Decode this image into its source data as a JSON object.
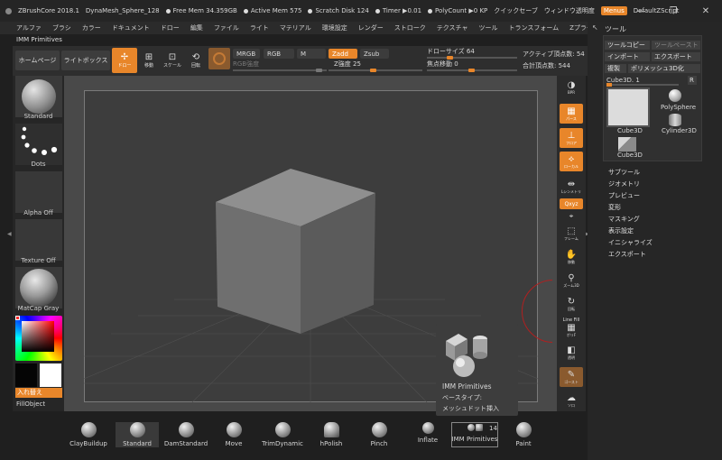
{
  "titlebar": {
    "app": "ZBrushCore 2018.1",
    "document": "DynaMesh_Sphere_128",
    "free_mem": "Free Mem 34.359GB",
    "active_mem": "Active Mem 575",
    "scratch": "Scratch Disk 124",
    "timer": "Timer ▶0.01",
    "polycount": "PolyCount ▶0 KP",
    "quicksave": "クイックセーブ",
    "transparency": "ウィンドウ透明度",
    "menus": "Menus",
    "script": "DefaultZScript",
    "min": "—",
    "restore": "❐",
    "close": "✕"
  },
  "menubar": [
    "アルファ",
    "ブラシ",
    "カラー",
    "ドキュメント",
    "ドロー",
    "編集",
    "ファイル",
    "ライト",
    "マテリアル",
    "環境設定",
    "レンダー",
    "ストローク",
    "テクスチャ",
    "ツール",
    "トランスフォーム",
    "Zプラグイン"
  ],
  "panel_name": "IMM Primitives",
  "shelf": {
    "home": "ホームページ",
    "lightbox": "ライトボックス",
    "draw": "ドロー",
    "move": "移動",
    "scale": "スケール",
    "rotate": "回転",
    "mrgb": "MRGB",
    "rgb": "RGB",
    "m": "M",
    "zadd": "Zadd",
    "zsub": "Zsub",
    "rgb_intensity": "RGB強度",
    "z_intensity": "Z強度 25",
    "draw_size": "ドローサイズ 64",
    "focal_shift": "焦点移動 0",
    "active_points": "アクティブ頂点数: 54",
    "total_points": "合計頂点数: 544"
  },
  "left": {
    "brush": "Standard",
    "stroke": "Dots",
    "alpha": "Alpha Off",
    "texture": "Texture Off",
    "material": "MatCap Gray",
    "swap": "入れ替え",
    "fill": "FillObject"
  },
  "right_toolbar": {
    "bpr": "BPR",
    "persp": "パース",
    "floor": "フロア",
    "local": "ローカル",
    "lsym": "Lシンメトリ",
    "xyz": "Qxyz",
    "frame": "フレーム",
    "move": "移動",
    "zoom": "ズーム3D",
    "rotate": "回転",
    "linefill": "Line Fill",
    "polyf": "ポリF",
    "transp": "透明",
    "ghost": "ゴースト",
    "solo": "ソロ"
  },
  "toolpanel": {
    "title": "ツール",
    "copy_tool": "ツールコピー",
    "paste_tool": "ツールペースト",
    "import": "インポート",
    "export": "エクスポート",
    "clone": "複製",
    "polymesh": "ポリメッシュ3D化",
    "current": "Cube3D. 1",
    "r": "R",
    "items": [
      "Cube3D",
      "PolySphere",
      "Cylinder3D",
      "Cube3D"
    ],
    "sections": [
      "サブツール",
      "ジオメトリ",
      "プレビュー",
      "変形",
      "マスキング",
      "表示設定",
      "イニシャライズ",
      "エクスポート"
    ]
  },
  "bottom_brushes": [
    "ClayBuildup",
    "Standard",
    "DamStandard",
    "Move",
    "TrimDynamic",
    "hPolish",
    "Pinch",
    "Inflate",
    "IMM Primitives",
    "Paint"
  ],
  "imm_count": "14",
  "popup": {
    "title": "IMM Primitives",
    "line1": "ベースタイプ:",
    "line2": "メッシュドット挿入"
  },
  "colors": {
    "accent": "#e8862a",
    "canvas": "#494949",
    "panel": "#262626"
  }
}
